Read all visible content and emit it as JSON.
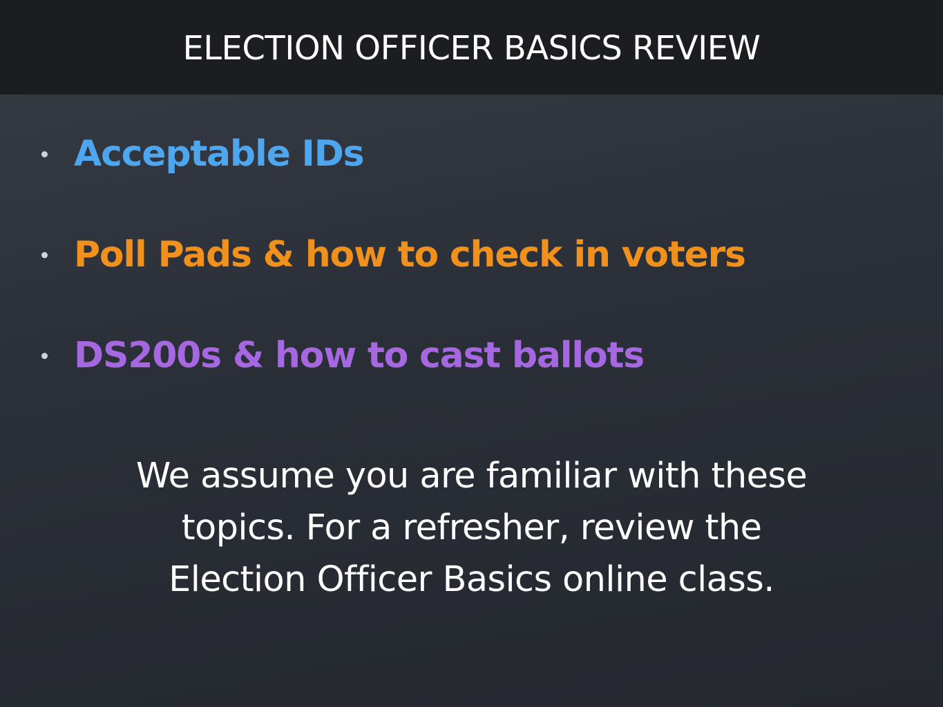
{
  "slide": {
    "title": "ELECTION OFFICER BASICS REVIEW",
    "bullets": [
      {
        "text": "Acceptable IDs",
        "color": "#4ea6ef"
      },
      {
        "text": "Poll Pads & how to check in voters",
        "color": "#f0901d"
      },
      {
        "text": "DS200s & how to cast ballots",
        "color": "#a668e0"
      }
    ],
    "note_lines": [
      "We assume you are familiar with these",
      "topics. For a refresher, review the",
      "Election Officer Basics online class."
    ]
  },
  "colors": {
    "title_bar": "#1c1d21",
    "background": "#2b2f37",
    "text": "#ffffff"
  }
}
